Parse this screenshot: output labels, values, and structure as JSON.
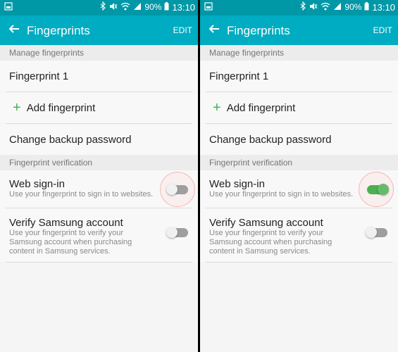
{
  "panels": [
    {
      "status": {
        "battery": "90%",
        "time": "13:10"
      },
      "appbar": {
        "title": "Fingerprints",
        "edit_label": "EDIT"
      },
      "sections": {
        "manage_header": "Manage fingerprints",
        "fingerprint_1": "Fingerprint 1",
        "add_fingerprint": "Add fingerprint",
        "change_backup": "Change backup password",
        "verification_header": "Fingerprint verification"
      },
      "web_signin": {
        "title": "Web sign-in",
        "subtitle": "Use your fingerprint to sign in to websites.",
        "enabled": false
      },
      "verify_samsung": {
        "title": "Verify Samsung account",
        "subtitle": "Use your fingerprint to verify your Samsung account when purchasing content in Samsung services.",
        "enabled": false
      }
    },
    {
      "status": {
        "battery": "90%",
        "time": "13:10"
      },
      "appbar": {
        "title": "Fingerprints",
        "edit_label": "EDIT"
      },
      "sections": {
        "manage_header": "Manage fingerprints",
        "fingerprint_1": "Fingerprint 1",
        "add_fingerprint": "Add fingerprint",
        "change_backup": "Change backup password",
        "verification_header": "Fingerprint verification"
      },
      "web_signin": {
        "title": "Web sign-in",
        "subtitle": "Use your fingerprint to sign in to websites.",
        "enabled": true
      },
      "verify_samsung": {
        "title": "Verify Samsung account",
        "subtitle": "Use your fingerprint to verify your Samsung account when purchasing content in Samsung services.",
        "enabled": false
      }
    }
  ],
  "colors": {
    "appbar": "#00acc1",
    "statusbar": "#0097a7",
    "toggle_on": "#4caf50",
    "toggle_off": "#9e9e9e",
    "highlight_ring": "#f4b6b6"
  },
  "icons": {
    "back": "arrow-left-icon",
    "add": "plus-icon",
    "status": [
      "image-notification-icon",
      "bluetooth-icon",
      "mute-icon",
      "wifi-icon",
      "signal-icon"
    ]
  }
}
